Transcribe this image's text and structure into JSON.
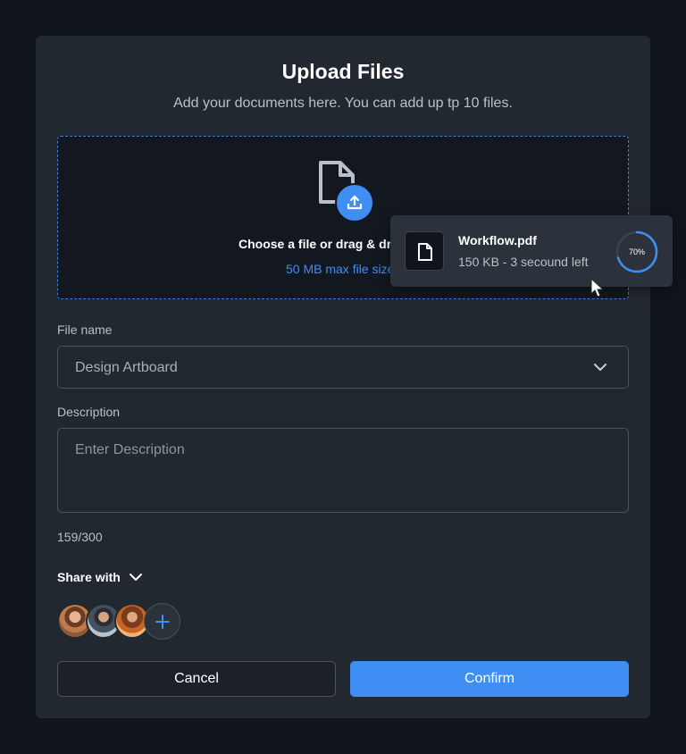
{
  "dialog": {
    "title": "Upload Files",
    "subtitle": "Add your documents here. You can add up tp 10 files."
  },
  "dropzone": {
    "title": "Choose a file or drag & drop it here",
    "hint": "50 MB max file size",
    "doc_icon": "document-icon",
    "upload_icon": "upload-icon"
  },
  "upload_item": {
    "file_name": "Workflow.pdf",
    "meta": "150 KB - 3 secound left",
    "progress": 0.7,
    "progress_label": "70%",
    "icon": "file-icon"
  },
  "form": {
    "file_name_label": "File name",
    "file_name_value": "Design Artboard",
    "description_label": "Description",
    "description_placeholder": "Enter Description",
    "counter": "159/300"
  },
  "share": {
    "label": "Share with",
    "add_icon": "plus-icon"
  },
  "actions": {
    "cancel": "Cancel",
    "confirm": "Confirm"
  },
  "colors": {
    "background": "#0f141d",
    "dialog": "#22282f",
    "accent": "#3e8ef3",
    "text": "#ffffff",
    "muted": "#b9c0c8"
  }
}
